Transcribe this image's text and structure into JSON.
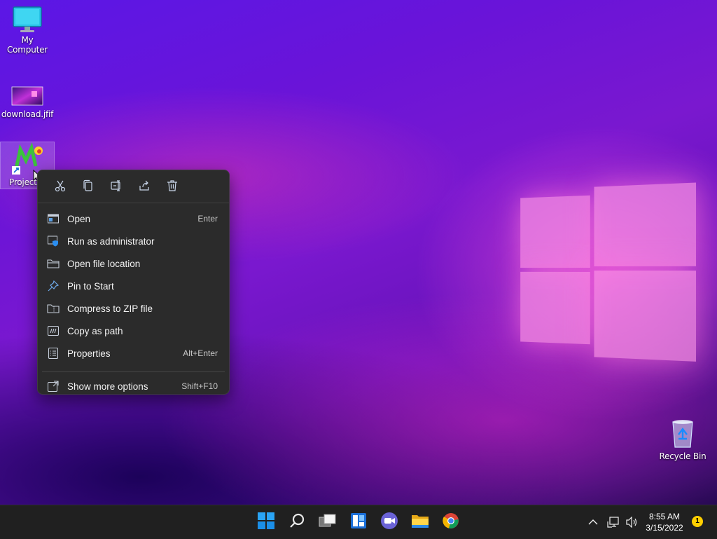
{
  "desktop": {
    "icons": [
      {
        "label": "My Computer",
        "icon": "monitor-icon"
      },
      {
        "label": "download.jfif",
        "icon": "image-file-icon"
      },
      {
        "label": "Project",
        "icon": "project-shortcut-icon"
      },
      {
        "label": "Recycle Bin",
        "icon": "recycle-bin-icon"
      }
    ]
  },
  "context_menu": {
    "toolbar": [
      {
        "action": "Cut",
        "icon": "cut-icon"
      },
      {
        "action": "Copy",
        "icon": "copy-icon"
      },
      {
        "action": "Rename",
        "icon": "rename-icon"
      },
      {
        "action": "Share",
        "icon": "share-icon"
      },
      {
        "action": "Delete",
        "icon": "delete-icon"
      }
    ],
    "items": [
      {
        "label": "Open",
        "shortcut": "Enter",
        "icon": "open-icon"
      },
      {
        "label": "Run as administrator",
        "shortcut": "",
        "icon": "shield-icon"
      },
      {
        "label": "Open file location",
        "shortcut": "",
        "icon": "folder-icon"
      },
      {
        "label": "Pin to Start",
        "shortcut": "",
        "icon": "pin-icon"
      },
      {
        "label": "Compress to ZIP file",
        "shortcut": "",
        "icon": "zip-icon"
      },
      {
        "label": "Copy as path",
        "shortcut": "",
        "icon": "path-icon"
      },
      {
        "label": "Properties",
        "shortcut": "Alt+Enter",
        "icon": "properties-icon"
      }
    ],
    "more": {
      "label": "Show more options",
      "shortcut": "Shift+F10",
      "icon": "more-options-icon"
    }
  },
  "taskbar": {
    "apps": [
      "start-icon",
      "search-icon",
      "task-view-icon",
      "widgets-icon",
      "chat-icon",
      "file-explorer-icon",
      "chrome-icon"
    ],
    "tray": [
      "chevron-up-icon",
      "network-icon",
      "volume-icon"
    ],
    "time": "8:55 AM",
    "date": "3/15/2022",
    "notification_count": "1"
  },
  "colors": {
    "menu_bg": "#2b2b2b",
    "accent": "#0078d4",
    "taskbar_bg": "#202020"
  }
}
